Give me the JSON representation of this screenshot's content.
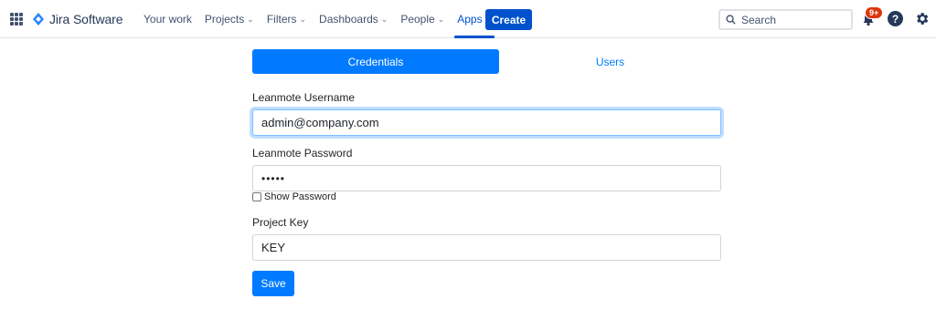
{
  "header": {
    "app_switcher_icon": "grid-icon",
    "logo_text": "Jira Software",
    "nav": [
      {
        "label": "Your work",
        "has_dropdown": false
      },
      {
        "label": "Projects",
        "has_dropdown": true
      },
      {
        "label": "Filters",
        "has_dropdown": true
      },
      {
        "label": "Dashboards",
        "has_dropdown": true
      },
      {
        "label": "People",
        "has_dropdown": true
      },
      {
        "label": "Apps",
        "has_dropdown": true,
        "active": true
      }
    ],
    "create_label": "Create",
    "search_placeholder": "Search",
    "notification_badge": "9+",
    "help_glyph": "?"
  },
  "tabs": {
    "credentials_label": "Credentials",
    "users_label": "Users",
    "active": "Credentials"
  },
  "form": {
    "username_label": "Leanmote Username",
    "username_value": "admin@company.com",
    "password_label": "Leanmote Password",
    "password_value": "•••••",
    "show_password_label": "Show Password",
    "project_key_label": "Project Key",
    "project_key_value": "KEY",
    "save_label": "Save"
  },
  "colors": {
    "jira_blue": "#0052cc",
    "primary": "#007bff",
    "badge_red": "#de350b"
  }
}
